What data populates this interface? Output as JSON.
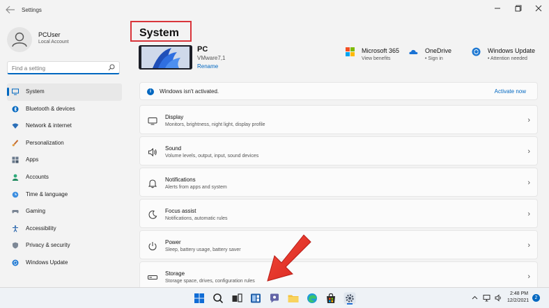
{
  "window": {
    "app_title": "Settings",
    "back_icon": "back-arrow-icon",
    "controls": [
      "minimize-icon",
      "maximize-icon",
      "close-icon"
    ]
  },
  "user": {
    "name": "PCUser",
    "account_type": "Local Account"
  },
  "search": {
    "placeholder": "Find a setting",
    "value": ""
  },
  "sidebar": {
    "items": [
      {
        "label": "System",
        "icon": "system-icon",
        "active": true
      },
      {
        "label": "Bluetooth & devices",
        "icon": "bluetooth-icon"
      },
      {
        "label": "Network & internet",
        "icon": "wifi-icon"
      },
      {
        "label": "Personalization",
        "icon": "brush-icon"
      },
      {
        "label": "Apps",
        "icon": "apps-icon"
      },
      {
        "label": "Accounts",
        "icon": "accounts-icon"
      },
      {
        "label": "Time & language",
        "icon": "globe-clock-icon"
      },
      {
        "label": "Gaming",
        "icon": "gamepad-icon"
      },
      {
        "label": "Accessibility",
        "icon": "accessibility-icon"
      },
      {
        "label": "Privacy & security",
        "icon": "shield-icon"
      },
      {
        "label": "Windows Update",
        "icon": "windows-update-icon"
      }
    ]
  },
  "main": {
    "title": "System",
    "pc": {
      "name": "PC",
      "model": "VMware7,1",
      "rename_label": "Rename"
    },
    "quick_links": [
      {
        "title": "Microsoft 365",
        "sub": "View benefits",
        "icon": "microsoft-365-icon"
      },
      {
        "title": "OneDrive",
        "sub": "• Sign in",
        "icon": "onedrive-icon"
      },
      {
        "title": "Windows Update",
        "sub": "• Attention needed",
        "icon": "windows-update-icon"
      }
    ],
    "activation": {
      "text": "Windows isn't activated.",
      "link": "Activate now"
    },
    "rows": [
      {
        "title": "Display",
        "sub": "Monitors, brightness, night light, display profile",
        "icon": "display-icon"
      },
      {
        "title": "Sound",
        "sub": "Volume levels, output, input, sound devices",
        "icon": "speaker-icon"
      },
      {
        "title": "Notifications",
        "sub": "Alerts from apps and system",
        "icon": "bell-icon"
      },
      {
        "title": "Focus assist",
        "sub": "Notifications, automatic rules",
        "icon": "moon-icon"
      },
      {
        "title": "Power",
        "sub": "Sleep, battery usage, battery saver",
        "icon": "power-icon"
      },
      {
        "title": "Storage",
        "sub": "Storage space, drives, configuration rules",
        "icon": "storage-icon"
      }
    ]
  },
  "taskbar": {
    "icons": [
      "windows-start-icon",
      "search-icon",
      "task-view-icon",
      "widgets-icon",
      "teams-chat-icon",
      "file-explorer-icon",
      "edge-icon",
      "store-icon",
      "settings-icon"
    ],
    "time": "2:48 PM",
    "date": "12/2/2021",
    "notification_count": "2"
  },
  "colors": {
    "accent": "#0067c0",
    "highlight_box": "#d9343a",
    "annotation_arrow": "#e8352f"
  }
}
